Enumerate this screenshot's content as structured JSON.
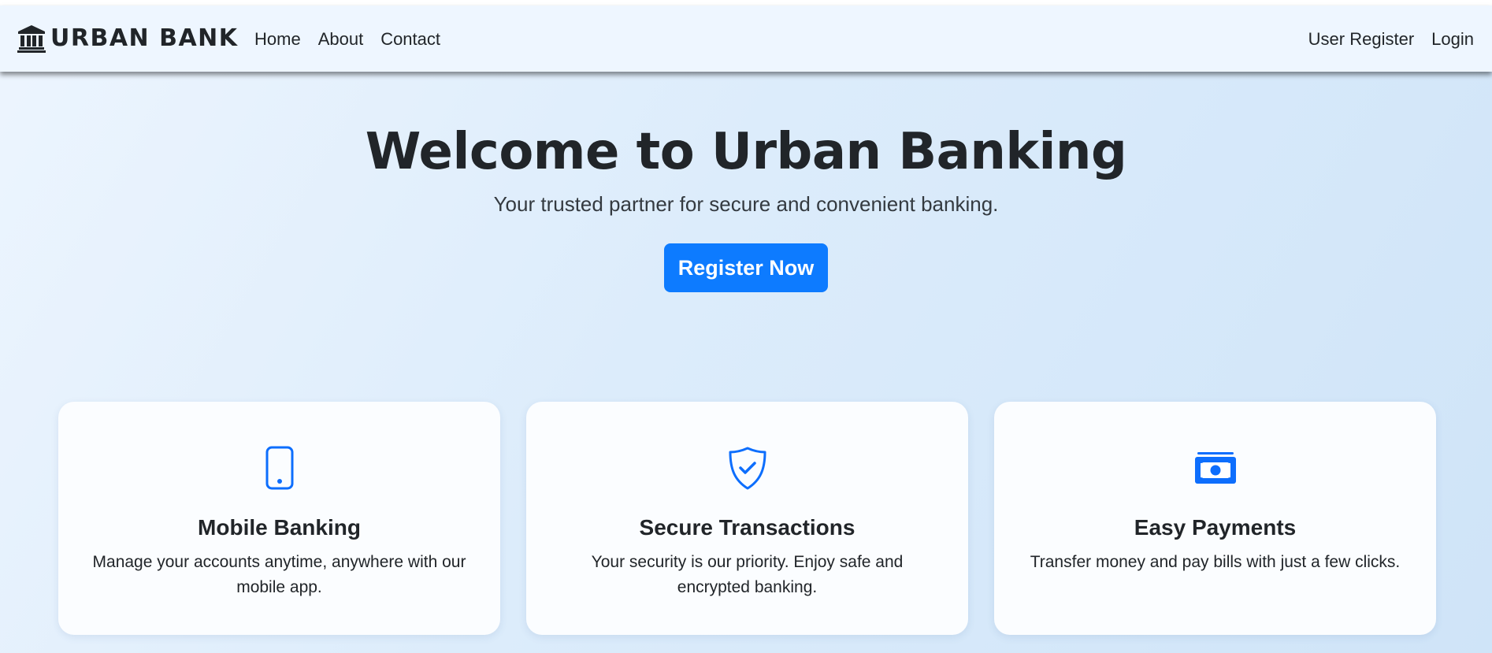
{
  "navbar": {
    "brand": "URBAN BANK",
    "brand_icon": "bank-building-icon",
    "links": [
      "Home",
      "About",
      "Contact"
    ],
    "right_links": [
      "User Register",
      "Login"
    ]
  },
  "hero": {
    "title": "Welcome to Urban Banking",
    "subtitle": "Your trusted partner for secure and convenient banking.",
    "cta_label": "Register Now"
  },
  "features": [
    {
      "icon": "phone-icon",
      "title": "Mobile Banking",
      "text": "Manage your accounts anytime, anywhere with our mobile app."
    },
    {
      "icon": "shield-check-icon",
      "title": "Secure Transactions",
      "text": "Your security is our priority. Enjoy safe and encrypted banking."
    },
    {
      "icon": "cash-icon",
      "title": "Easy Payments",
      "text": "Transfer money and pay bills with just a few clicks."
    }
  ],
  "colors": {
    "accent": "#0d7bff",
    "navbar_bg": "#eef6ff",
    "text": "#212529"
  }
}
